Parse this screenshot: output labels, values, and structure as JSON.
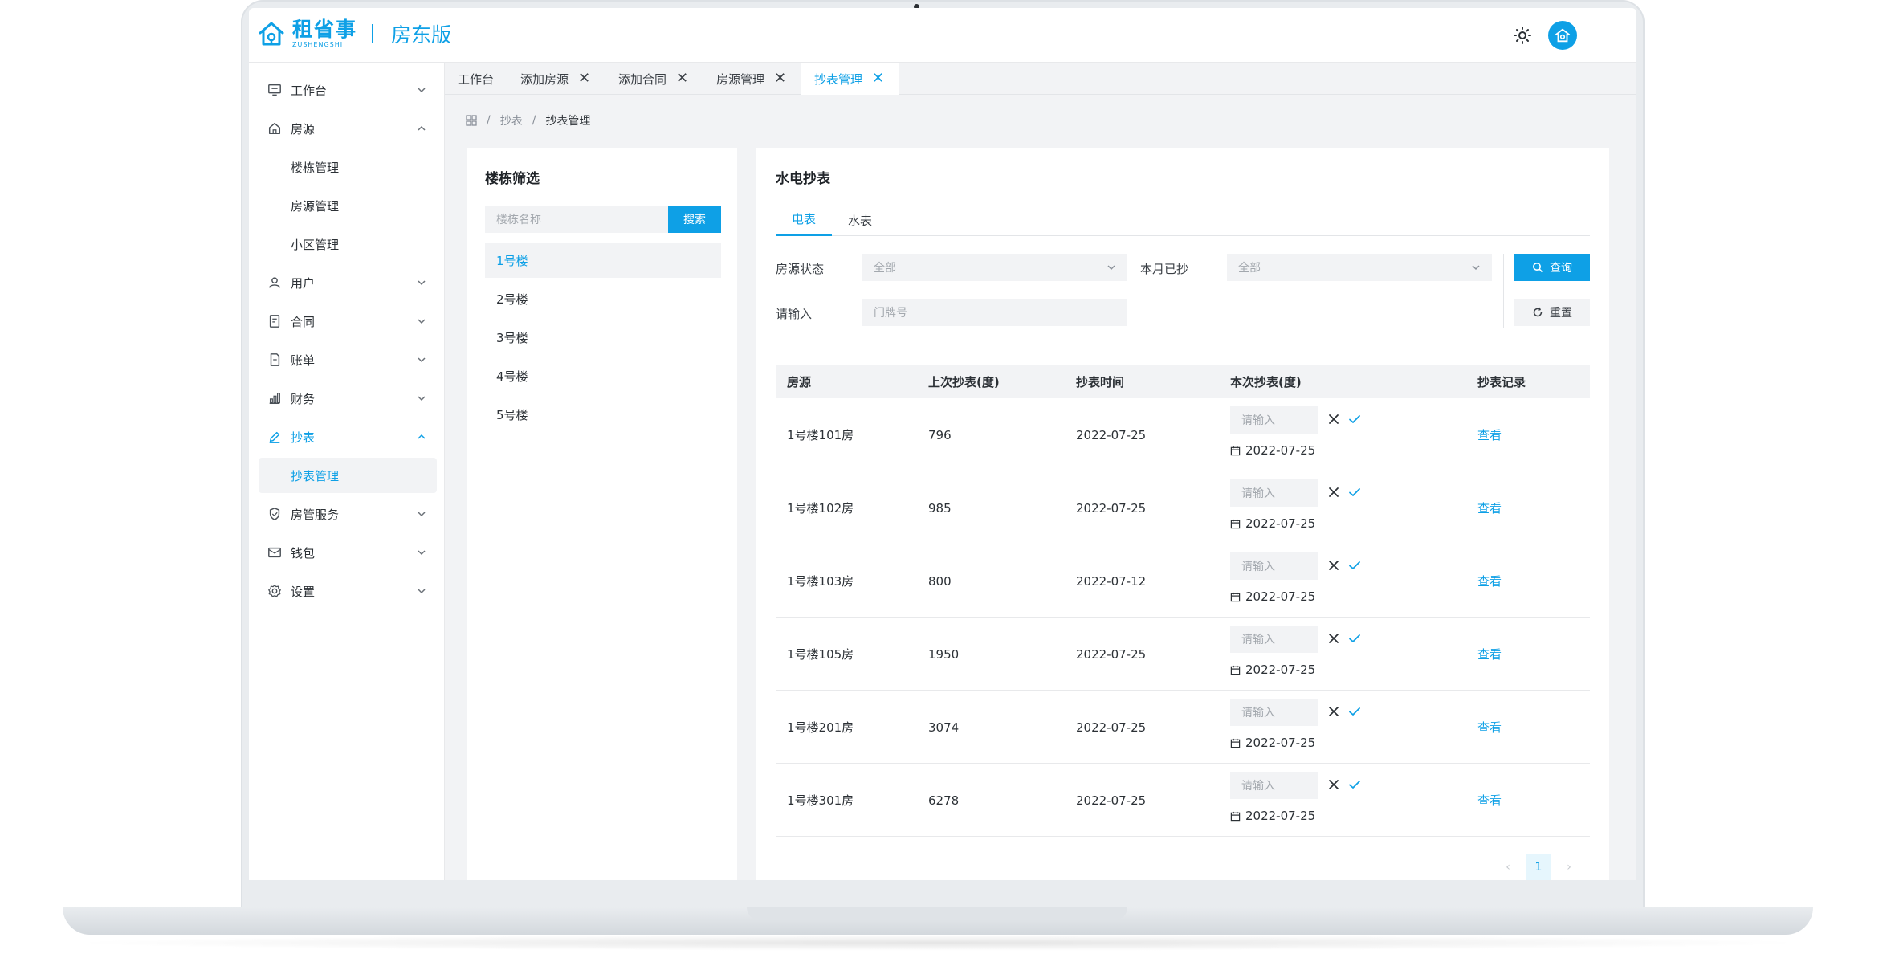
{
  "brand": {
    "name_cn": "租省事",
    "name_en": "ZUSHENGSHI",
    "edition": "房东版"
  },
  "colors": {
    "accent": "#0ea0e6",
    "panel_bg": "#f2f3f5"
  },
  "sidebar": {
    "items": [
      {
        "label": "工作台",
        "icon": "monitor-icon",
        "expanded": false
      },
      {
        "label": "房源",
        "icon": "home-icon",
        "expanded": true
      },
      {
        "label": "楼栋管理"
      },
      {
        "label": "房源管理"
      },
      {
        "label": "小区管理"
      },
      {
        "label": "用户",
        "icon": "user-icon",
        "expanded": false
      },
      {
        "label": "合同",
        "icon": "contract-icon",
        "expanded": false
      },
      {
        "label": "账单",
        "icon": "bill-icon",
        "expanded": false
      },
      {
        "label": "财务",
        "icon": "finance-chart-icon",
        "expanded": false
      },
      {
        "label": "抄表",
        "icon": "pen-icon",
        "expanded": true
      },
      {
        "label": "抄表管理"
      },
      {
        "label": "房管服务",
        "icon": "shield-icon",
        "expanded": false
      },
      {
        "label": "钱包",
        "icon": "wallet-icon",
        "expanded": false
      },
      {
        "label": "设置",
        "icon": "gear-icon",
        "expanded": false
      }
    ]
  },
  "tabs": [
    {
      "label": "工作台",
      "closable": false
    },
    {
      "label": "添加房源",
      "closable": true
    },
    {
      "label": "添加合同",
      "closable": true
    },
    {
      "label": "房源管理",
      "closable": true
    },
    {
      "label": "抄表管理",
      "closable": true,
      "active": true
    }
  ],
  "tab_close_glyph": "✕",
  "breadcrumb": {
    "sep": "/",
    "level1": "抄表",
    "current": "抄表管理"
  },
  "building_filter": {
    "title": "楼栋筛选",
    "search_placeholder": "楼栋名称",
    "search_button": "搜索",
    "buildings": [
      "1号楼",
      "2号楼",
      "3号楼",
      "4号楼",
      "5号楼"
    ],
    "selected": 0
  },
  "meter": {
    "title": "水电抄表",
    "tabs": [
      "电表",
      "水表"
    ],
    "active_tab": 0,
    "filters": {
      "status_label": "房源状态",
      "status_value": "全部",
      "read_label": "本月已抄",
      "read_value": "全部",
      "input_label": "请输入",
      "input_placeholder": "门牌号",
      "query_button": "查询",
      "reset_button": "重置"
    },
    "table": {
      "headers": [
        "房源",
        "上次抄表(度)",
        "抄表时间",
        "本次抄表(度)",
        "抄表记录"
      ],
      "input_placeholder": "请输入",
      "view_label": "查看",
      "rows": [
        {
          "room": "1号楼101房",
          "last": "796",
          "time": "2022-07-25",
          "date": "2022-07-25"
        },
        {
          "room": "1号楼102房",
          "last": "985",
          "time": "2022-07-25",
          "date": "2022-07-25"
        },
        {
          "room": "1号楼103房",
          "last": "800",
          "time": "2022-07-12",
          "date": "2022-07-25"
        },
        {
          "room": "1号楼105房",
          "last": "1950",
          "time": "2022-07-25",
          "date": "2022-07-25"
        },
        {
          "room": "1号楼201房",
          "last": "3074",
          "time": "2022-07-25",
          "date": "2022-07-25"
        },
        {
          "room": "1号楼301房",
          "last": "6278",
          "time": "2022-07-25",
          "date": "2022-07-25"
        }
      ]
    },
    "pagination": {
      "prev": "‹",
      "current": "1",
      "next": "›"
    }
  }
}
